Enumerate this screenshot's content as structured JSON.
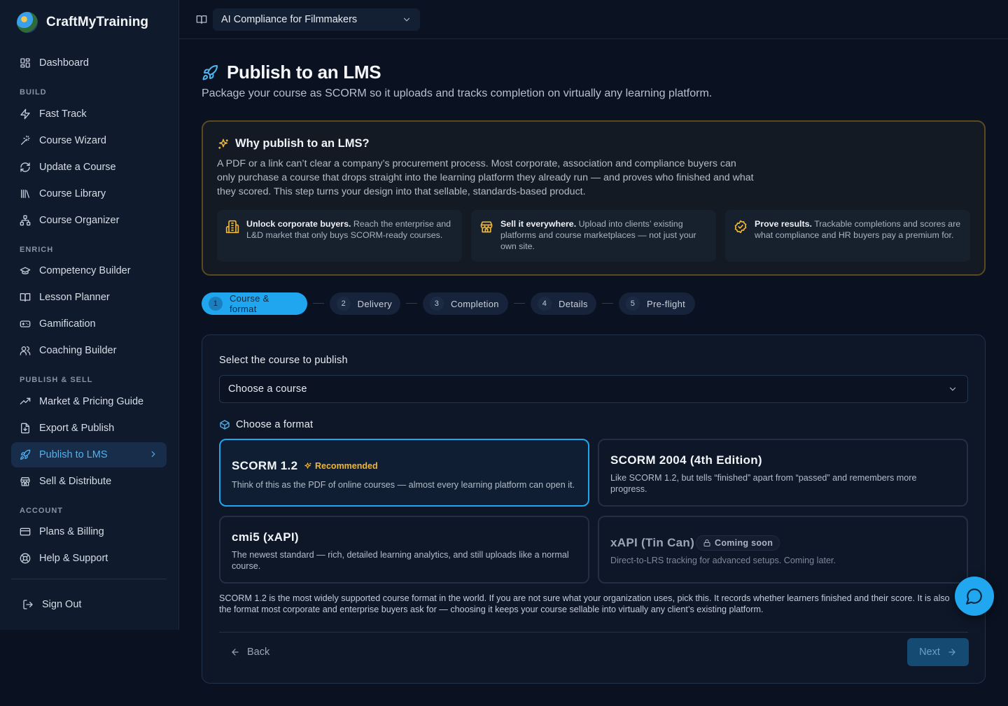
{
  "brand": {
    "name": "CraftMyTraining"
  },
  "sidebar": {
    "dashboard": "Dashboard",
    "sections": {
      "build": "BUILD",
      "enrich": "ENRICH",
      "publish": "PUBLISH & SELL",
      "account": "ACCOUNT"
    },
    "items": [
      {
        "label": "Fast Track",
        "icon": "zap-icon"
      },
      {
        "label": "Course Wizard",
        "icon": "magic-wand-icon"
      },
      {
        "label": "Update a Course",
        "icon": "refresh-icon"
      },
      {
        "label": "Course Library",
        "icon": "library-icon"
      },
      {
        "label": "Course Organizer",
        "icon": "workflow-icon"
      },
      {
        "label": "Competency Builder",
        "icon": "graduation-cap-icon"
      },
      {
        "label": "Lesson Planner",
        "icon": "book-open-icon"
      },
      {
        "label": "Gamification",
        "icon": "gamepad-icon"
      },
      {
        "label": "Coaching Builder",
        "icon": "users-icon"
      },
      {
        "label": "Market & Pricing Guide",
        "icon": "trending-up-icon"
      },
      {
        "label": "Export & Publish",
        "icon": "file-download-icon"
      },
      {
        "label": "Publish to LMS",
        "icon": "rocket-icon",
        "active": true
      },
      {
        "label": "Sell & Distribute",
        "icon": "store-icon"
      },
      {
        "label": "Plans & Billing",
        "icon": "credit-card-icon"
      },
      {
        "label": "Help & Support",
        "icon": "lifebuoy-icon"
      }
    ],
    "sign_out": "Sign Out"
  },
  "topbar": {
    "selected_course": "AI Compliance for Filmmakers"
  },
  "page": {
    "title": "Publish to an LMS",
    "subtitle": "Package your course as SCORM so it uploads and tracks completion on virtually any learning platform."
  },
  "why": {
    "title": "Why publish to an LMS?",
    "body": "A PDF or a link can’t clear a company’s procurement process. Most corporate, association and compliance buyers can only purchase a course that drops straight into the learning platform they already run — and proves who finished and what they scored. This step turns your design into that sellable, standards-based product.",
    "benefits": [
      {
        "bold": "Unlock corporate buyers.",
        "text": "Reach the enterprise and L&D market that only buys SCORM-ready courses."
      },
      {
        "bold": "Sell it everywhere.",
        "text": "Upload into clients’ existing platforms and course marketplaces — not just your own site."
      },
      {
        "bold": "Prove results.",
        "text": "Trackable completions and scores are what compliance and HR buyers pay a premium for."
      }
    ]
  },
  "steps": [
    {
      "num": "1",
      "label": "Course & format",
      "active": true
    },
    {
      "num": "2",
      "label": "Delivery"
    },
    {
      "num": "3",
      "label": "Completion"
    },
    {
      "num": "4",
      "label": "Details"
    },
    {
      "num": "5",
      "label": "Pre-flight"
    }
  ],
  "form": {
    "select_label": "Select the course to publish",
    "select_placeholder": "Choose a course",
    "format_label": "Choose a format",
    "options": [
      {
        "title": "SCORM 1.2",
        "badge": "Recommended",
        "desc": "Think of this as the PDF of online courses — almost every learning platform can open it.",
        "selected": true
      },
      {
        "title": "SCORM 2004 (4th Edition)",
        "desc": "Like SCORM 1.2, but tells “finished” apart from “passed” and remembers more progress."
      },
      {
        "title": "cmi5 (xAPI)",
        "desc": "The newest standard — rich, detailed learning analytics, and still uploads like a normal course."
      },
      {
        "title": "xAPI (Tin Can)",
        "badge": "Coming soon",
        "desc": "Direct-to-LRS tracking for advanced setups. Coming later.",
        "disabled": true
      }
    ],
    "explanation_line1": "SCORM 1.2 is the most widely supported course format in the world. If you are not sure what your organization uses, pick this. It records whether learners finished and their score. It is also",
    "explanation_line2": "the format most corporate and enterprise buyers ask for — choosing it keeps your course sellable into virtually any client’s existing platform.",
    "back": "Back",
    "next": "Next"
  },
  "colors": {
    "accent": "#20a6ef",
    "highlight": "#f2b632",
    "background": "#0a1120"
  }
}
